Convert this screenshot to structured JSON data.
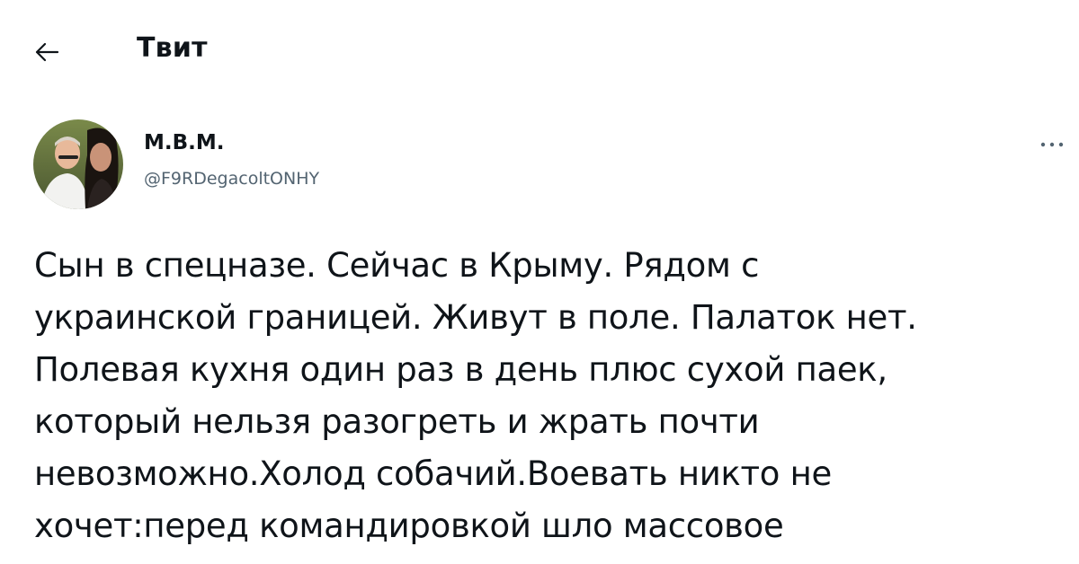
{
  "header": {
    "back_icon": "arrow-left-icon",
    "title": "Твит"
  },
  "author": {
    "avatar_icon": "profile-photo",
    "name": "М.В.М.",
    "handle": "@F9RDegacoltONHY"
  },
  "more_icon": "ellipsis-icon",
  "tweet": {
    "text": "Сын в спецназе. Сейчас в Крыму. Рядом с\nукраинской границей. Живут в поле. Палаток нет.\nПолевая кухня один раз в день плюс сухой паек,\nкоторый нельзя разогреть и жрать почти\nневозможно.Холод собачий.Воевать никто не\nхочет:перед командировкой шло массовое"
  }
}
